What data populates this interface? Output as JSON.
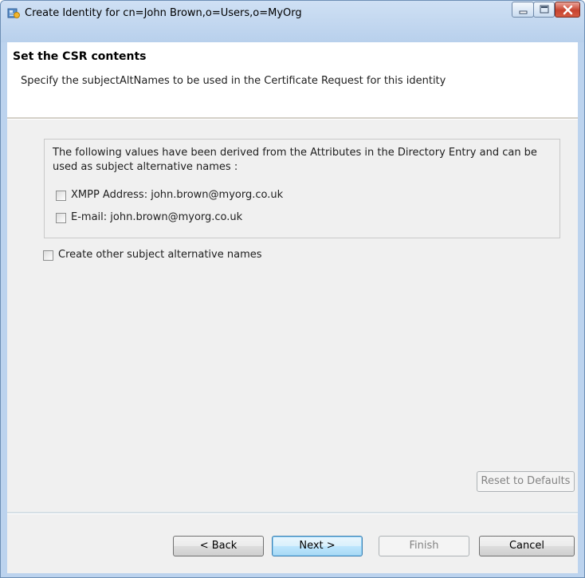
{
  "window": {
    "title": "Create Identity for cn=John Brown,o=Users,o=MyOrg",
    "icon": "identity-wizard-icon",
    "controls": [
      "minimize-icon",
      "maximize-icon",
      "close-icon"
    ]
  },
  "header": {
    "title": "Set the CSR contents",
    "description": "Specify the subjectAltNames to be used in the Certificate Request for this identity"
  },
  "derived_group": {
    "text": "The following values have been derived from the Attributes in the Directory Entry and can be used as subject alternative names :",
    "options": [
      {
        "label": "XMPP Address: john.brown@myorg.co.uk",
        "checked": false
      },
      {
        "label": "E-mail: john.brown@myorg.co.uk",
        "checked": false
      }
    ]
  },
  "other_option": {
    "label": "Create other subject alternative names",
    "checked": false
  },
  "buttons": {
    "reset": "Reset to Defaults",
    "back": "< Back",
    "next": "Next >",
    "finish": "Finish",
    "cancel": "Cancel"
  },
  "colors": {
    "title_bar": "#bcd3ee",
    "close_button": "#c7432f",
    "content_background": "#f0f0f0",
    "default_button_border": "#3c7fb1"
  }
}
